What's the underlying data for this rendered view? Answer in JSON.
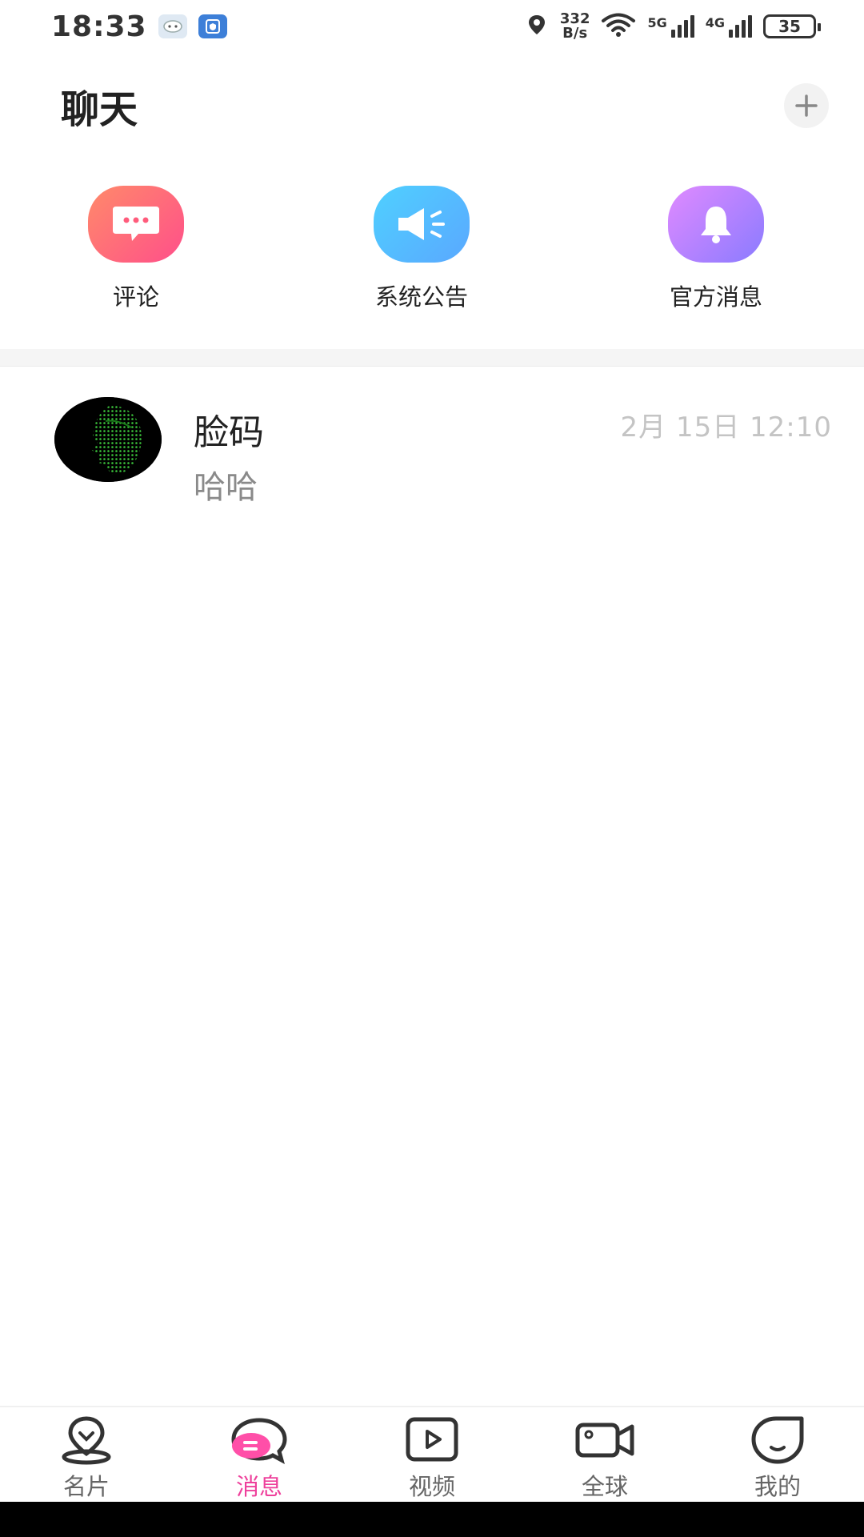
{
  "status_bar": {
    "time": "18:33",
    "net_speed_value": "332",
    "net_speed_unit": "B/s",
    "network_1": "5G",
    "network_2": "4G",
    "battery": "35"
  },
  "header": {
    "title": "聊天"
  },
  "entries": [
    {
      "label": "评论",
      "icon": "comment-icon",
      "color": "#ff5c7c"
    },
    {
      "label": "系统公告",
      "icon": "megaphone-icon",
      "color": "#4fc3ff"
    },
    {
      "label": "官方消息",
      "icon": "bell-icon",
      "color": "#b07cff"
    }
  ],
  "conversations": [
    {
      "name": "脸码",
      "last_message": "哈哈",
      "time": "2月 15日 12:10"
    }
  ],
  "bottom_nav": {
    "items": [
      {
        "label": "名片",
        "icon": "location-pin-icon"
      },
      {
        "label": "消息",
        "icon": "chat-bubble-icon",
        "active": true
      },
      {
        "label": "视频",
        "icon": "play-icon"
      },
      {
        "label": "全球",
        "icon": "video-camera-icon"
      },
      {
        "label": "我的",
        "icon": "profile-face-icon"
      }
    ],
    "active_color": "#ee3f9b"
  }
}
